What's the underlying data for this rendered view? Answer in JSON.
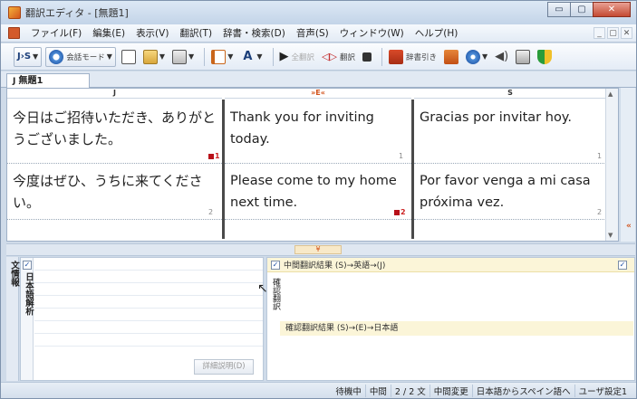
{
  "window": {
    "title": "翻訳エディタ - [無題1]",
    "controls": {
      "minimize": "▭",
      "maximize": "▢",
      "close": "✕"
    }
  },
  "menu": {
    "items": [
      "ファイル(F)",
      "編集(E)",
      "表示(V)",
      "翻訳(T)",
      "辞書・検索(D)",
      "音声(S)",
      "ウィンドウ(W)",
      "ヘルプ(H)"
    ],
    "mdi": [
      "_",
      "▢",
      "✕"
    ]
  },
  "toolbar": {
    "lang_pair": "J›S",
    "conversation_mode": "会話モード",
    "translate_all": "全翻訳",
    "translate": "翻訳",
    "dictionary_lookup": "辞書引き"
  },
  "document": {
    "tab_label": "無題1"
  },
  "editor": {
    "columns": [
      {
        "header": "J",
        "segments": [
          "今日はご招待いただき、ありがとうございました。",
          "今度はぜひ、うちに来てください。"
        ],
        "numbers": [
          "1",
          "2"
        ]
      },
      {
        "header": "»E«",
        "segments": [
          "Thank you for inviting today.",
          "Please come to my home next time."
        ],
        "numbers": [
          "1",
          "2"
        ]
      },
      {
        "header": "S",
        "segments": [
          "Gracias por invitar hoy.",
          "Por favor venga a mi casa próxima vez."
        ],
        "numbers": [
          "1",
          "2"
        ]
      }
    ],
    "right_marker": "«"
  },
  "splitter": {
    "handle": "¥"
  },
  "lower": {
    "sidebar_label": "文情報",
    "analysis_label": "日本語解析",
    "detail_button": "詳細説明(D)",
    "result_header": "中間翻訳結果 (S)→英語→(J)",
    "result_side_label": "確認翻訳",
    "result_sub": "確認翻訳結果 (S)→(E)→日本語",
    "checkbox_mark": "✓"
  },
  "status": {
    "fields": [
      "待機中",
      "中間",
      "2 / 2 文",
      "中間変更",
      "日本語からスペイン語へ",
      "ユーザ設定1"
    ]
  },
  "colors": {
    "accent_orange": "#d2541d",
    "chrome_blue": "#cfdbe9",
    "highlight_yellow": "#fbf5d8",
    "column_divider": "#4a4a4a"
  }
}
